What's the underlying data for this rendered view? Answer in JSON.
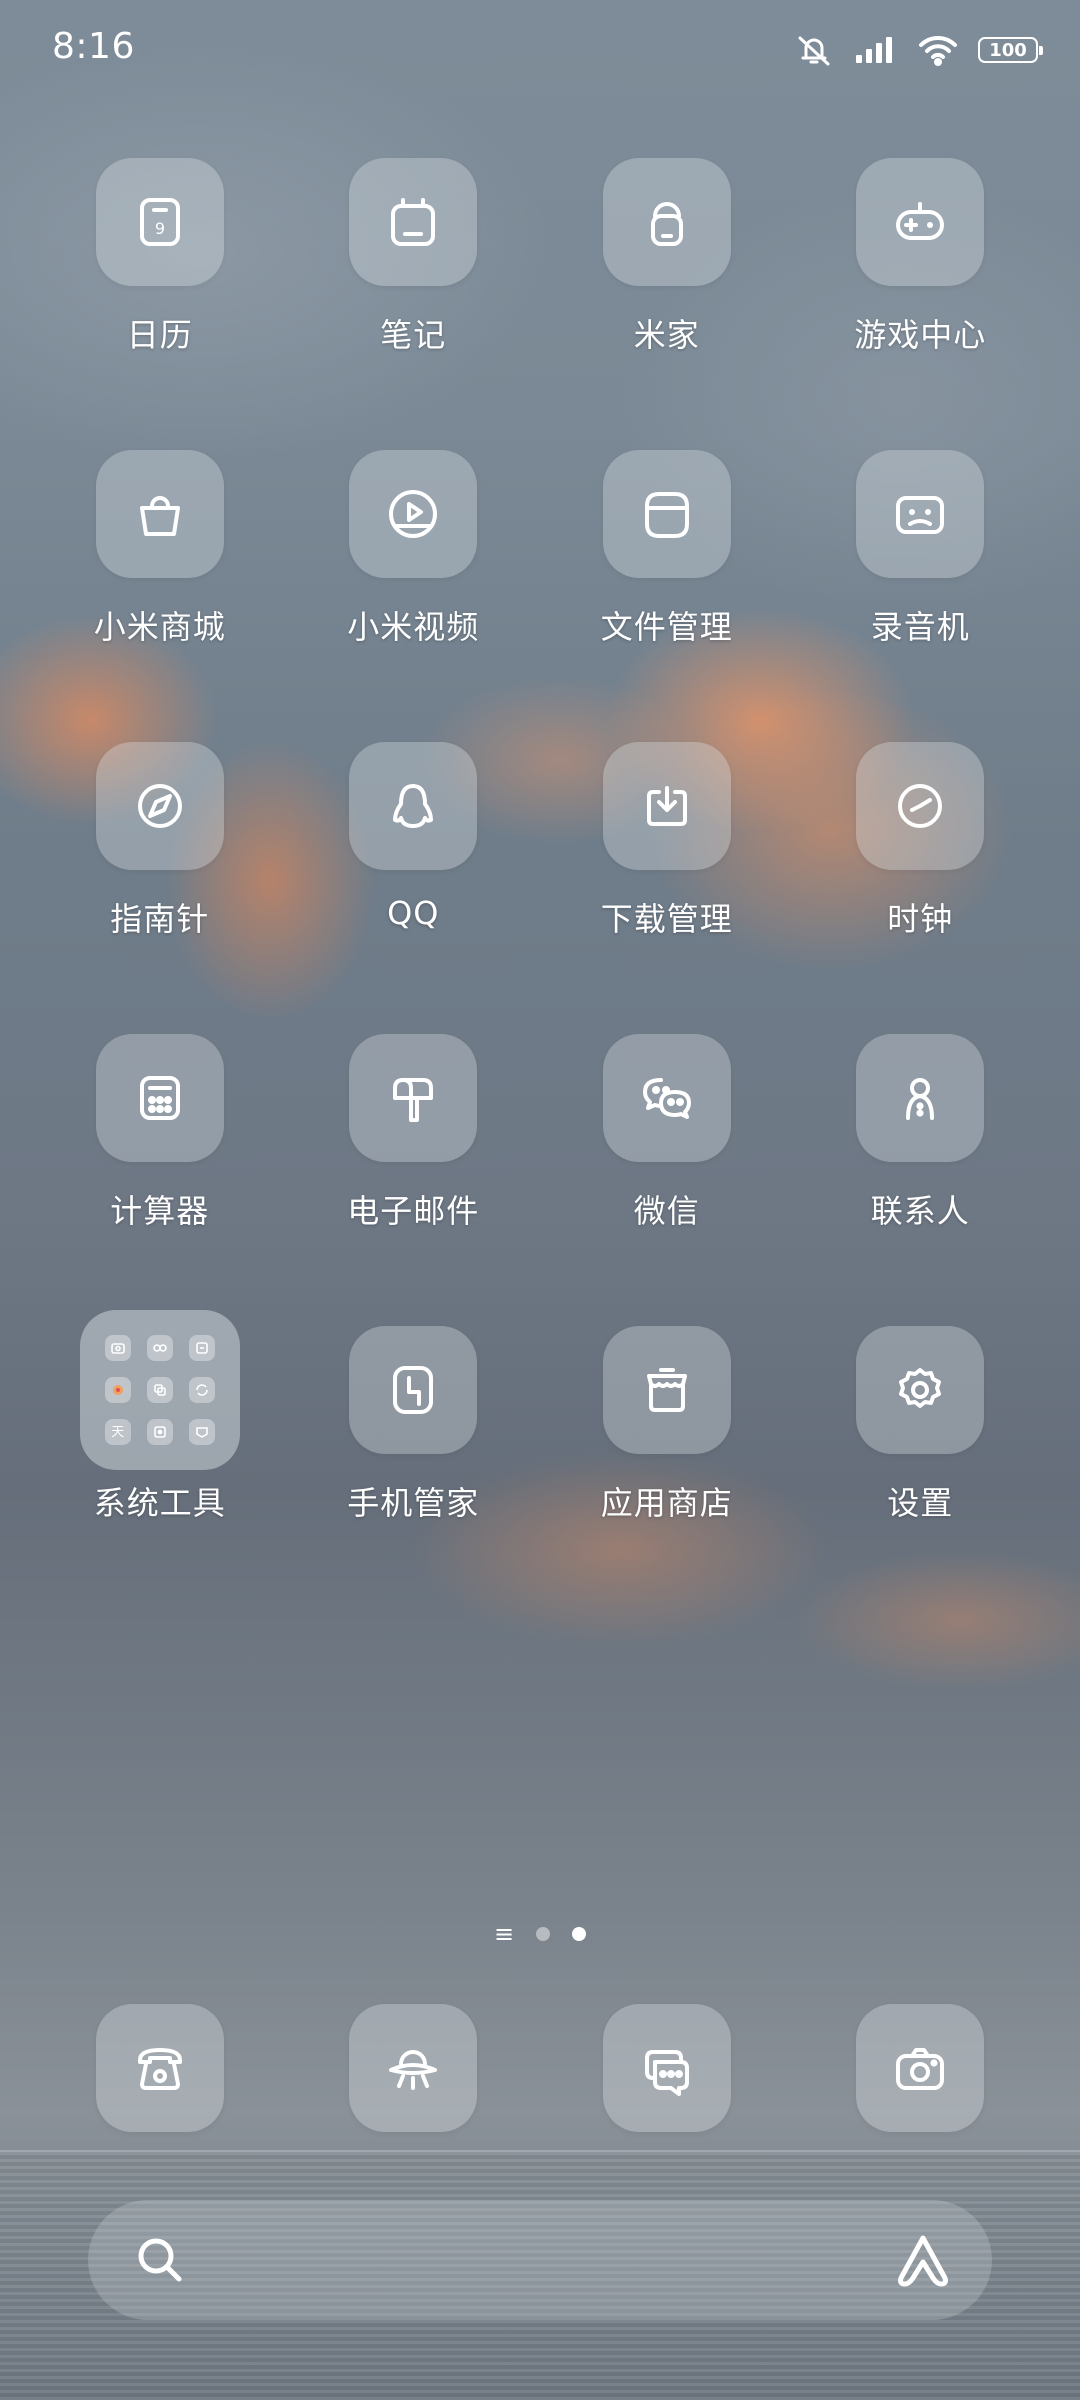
{
  "status_bar": {
    "time": "8:16",
    "battery": "100",
    "icons": [
      "mute-icon",
      "signal-icon",
      "wifi-icon",
      "battery-icon"
    ]
  },
  "apps": [
    {
      "label": "日历",
      "icon": "calendar-icon"
    },
    {
      "label": "笔记",
      "icon": "notes-icon"
    },
    {
      "label": "米家",
      "icon": "mi-home-icon"
    },
    {
      "label": "游戏中心",
      "icon": "game-center-icon"
    },
    {
      "label": "小米商城",
      "icon": "shopping-bag-icon"
    },
    {
      "label": "小米视频",
      "icon": "video-play-icon"
    },
    {
      "label": "文件管理",
      "icon": "file-manager-icon"
    },
    {
      "label": "录音机",
      "icon": "recorder-icon"
    },
    {
      "label": "指南针",
      "icon": "compass-icon"
    },
    {
      "label": "QQ",
      "icon": "qq-penguin-icon"
    },
    {
      "label": "下载管理",
      "icon": "download-icon"
    },
    {
      "label": "时钟",
      "icon": "clock-icon"
    },
    {
      "label": "计算器",
      "icon": "calculator-icon"
    },
    {
      "label": "电子邮件",
      "icon": "mailbox-icon"
    },
    {
      "label": "微信",
      "icon": "wechat-icon"
    },
    {
      "label": "联系人",
      "icon": "contacts-icon"
    },
    {
      "label": "系统工具",
      "icon": "folder-icon"
    },
    {
      "label": "手机管家",
      "icon": "security-shield-icon"
    },
    {
      "label": "应用商店",
      "icon": "app-store-icon"
    },
    {
      "label": "设置",
      "icon": "gear-icon"
    }
  ],
  "folder_mini_icons": [
    "camera-mini-icon",
    "link-mini-icon",
    "scanner-mini-icon",
    "theme-mini-icon",
    "screen-mini-icon",
    "refresh-mini-icon",
    "weather-mini-icon",
    "box-mini-icon",
    "feedback-mini-icon"
  ],
  "folder_mini_text": {
    "weather": "天"
  },
  "page_indicator": {
    "pages": 2,
    "active": 2,
    "list_icon": "≡"
  },
  "dock": [
    {
      "icon": "phone-icon"
    },
    {
      "icon": "browser-ufo-icon"
    },
    {
      "icon": "messages-icon"
    },
    {
      "icon": "camera-icon"
    }
  ],
  "search_bar": {
    "search_icon": "search-icon",
    "assistant_icon": "assistant-icon"
  }
}
